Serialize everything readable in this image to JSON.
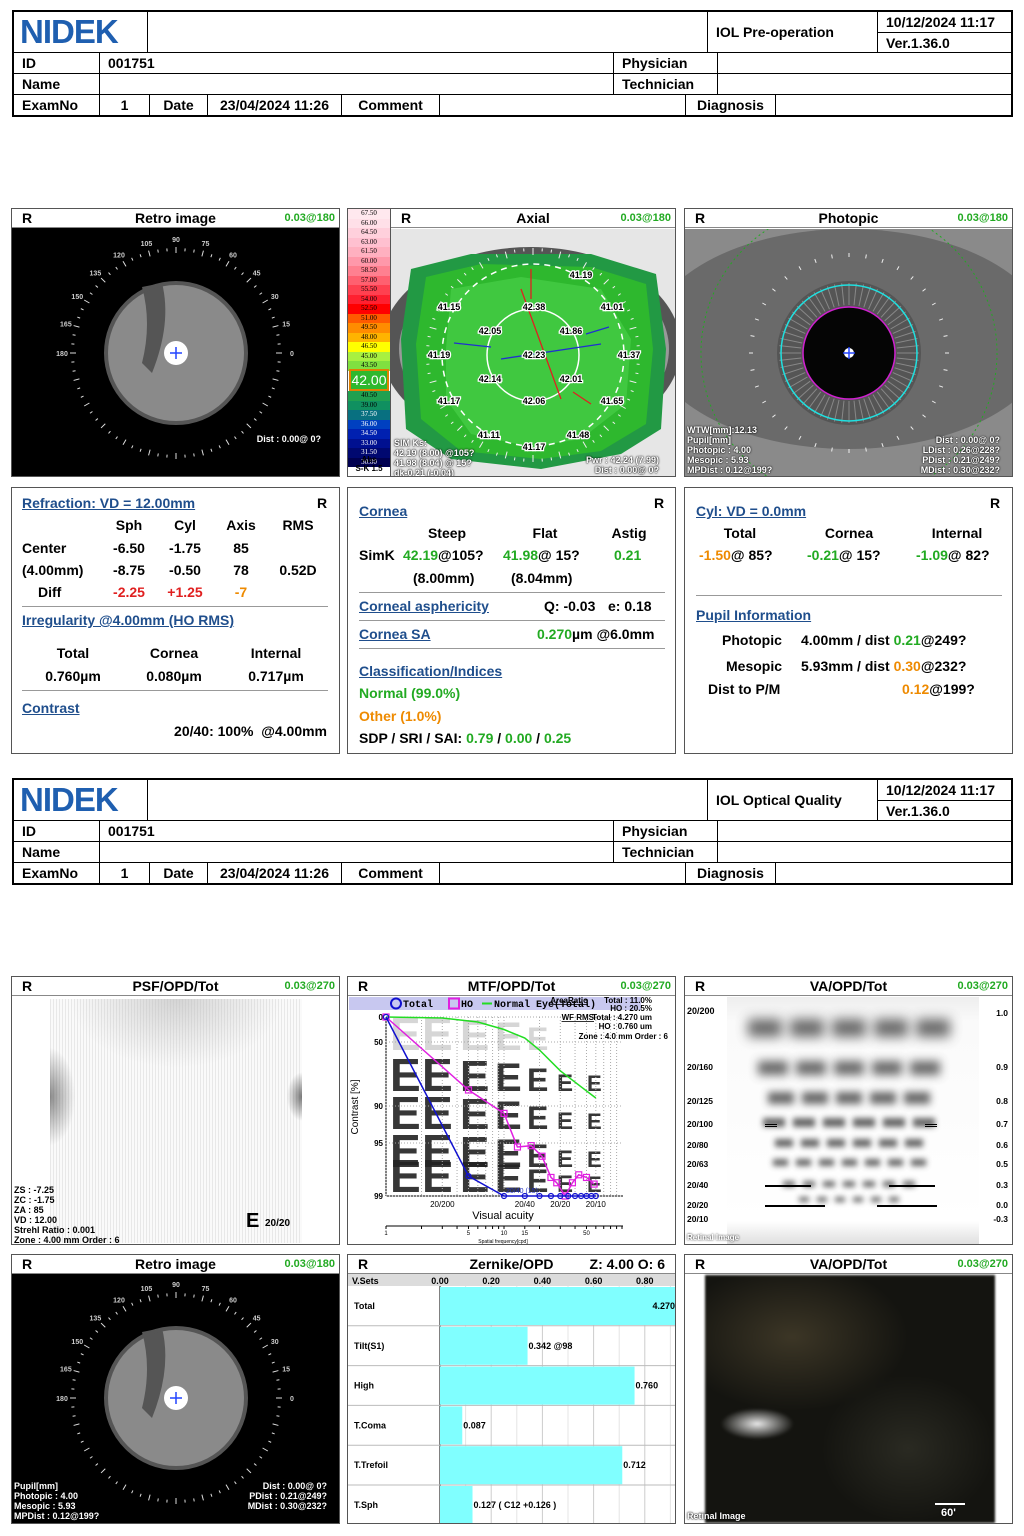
{
  "headers": [
    {
      "logo": "NIDEK",
      "report": "IOL Pre-operation",
      "datetime": "10/12/2024 11:17",
      "version": "Ver.1.36.0",
      "id_label": "ID",
      "id": "001751",
      "name_label": "Name",
      "name": "",
      "physician_label": "Physician",
      "physician": "",
      "technician_label": "Technician",
      "technician": "",
      "examno_label": "ExamNo",
      "examno": "1",
      "date_label": "Date",
      "date": "23/04/2024 11:26",
      "comment_label": "Comment",
      "diagnosis_label": "Diagnosis"
    },
    {
      "logo": "NIDEK",
      "report": "IOL Optical Quality",
      "datetime": "10/12/2024 11:17",
      "version": "Ver.1.36.0",
      "id_label": "ID",
      "id": "001751",
      "name_label": "Name",
      "name": "",
      "physician_label": "Physician",
      "physician": "",
      "technician_label": "Technician",
      "technician": "",
      "examno_label": "ExamNo",
      "examno": "1",
      "date_label": "Date",
      "date": "23/04/2024 11:26",
      "comment_label": "Comment",
      "diagnosis_label": "Diagnosis"
    }
  ],
  "eye": "R",
  "angle_labels": [
    "0",
    "15",
    "30",
    "45",
    "60",
    "75",
    "90",
    "105",
    "120",
    "135",
    "150",
    "165",
    "180"
  ],
  "retro1": {
    "title": "Retro image",
    "badge": "0.03@180",
    "dist": "Dist : 0.00@ 0?"
  },
  "axial": {
    "title": "Axial",
    "badge": "0.03@180",
    "scale": [
      "67.50",
      "66.00",
      "64.50",
      "63.00",
      "61.50",
      "60.00",
      "58.50",
      "57.00",
      "55.50",
      "54.00",
      "52.50",
      "51.00",
      "49.50",
      "48.00",
      "46.50",
      "45.00",
      "43.50",
      "42.00",
      "40.50",
      "39.00",
      "37.50",
      "36.00",
      "34.50",
      "33.00",
      "31.50",
      "30.00"
    ],
    "scale_selected": "42.00",
    "scale_mode": "Abs",
    "scale_step": "S-K 1.5",
    "values": [
      "41.19",
      "41.15",
      "42.38",
      "41.01",
      "42.05",
      "41.86",
      "41.19",
      "42.23",
      "41.37",
      "42.14",
      "42.01",
      "41.17",
      "42.06",
      "41.65",
      "41.11",
      "41.48",
      "41.17"
    ],
    "simk_lines": [
      "SIM Ks:",
      "42.19 (8.00) @105?",
      "41.98 (8.04) @ 15?",
      "dk-0.21 (-0.04)"
    ],
    "pwr": "Pwr : 42.24 (7.99)",
    "dist": "Dist : 0.00@ 0?"
  },
  "photopic": {
    "title": "Photopic",
    "badge": "0.03@180",
    "left_lines": [
      "WTW[mm]:12.13",
      "Pupil[mm]",
      "Photopic : 4.00",
      "Mesopic : 5.93",
      "MPDist : 0.12@199?"
    ],
    "right_lines": [
      "Dist : 0.00@ 0?",
      "LDist : 0.26@228?",
      "PDist : 0.21@249?",
      "MDist : 0.30@232?"
    ]
  },
  "refraction": {
    "title": "Refraction: VD = 12.00mm",
    "cols": [
      "Sph",
      "Cyl",
      "Axis",
      "RMS"
    ],
    "center_label": "Center",
    "center": [
      "-6.50",
      "-1.75",
      "85"
    ],
    "zone_label": "(4.00mm)",
    "zone": [
      "-8.75",
      "-0.50",
      "78",
      "0.52D"
    ],
    "diff_label": "Diff",
    "diff": [
      "-2.25",
      "+1.25",
      "-7"
    ],
    "irregularity_title": "Irregularity @4.00mm (HO RMS)",
    "irr_cols": [
      "Total",
      "Cornea",
      "Internal"
    ],
    "irr_vals": [
      "0.760µm",
      "0.080µm",
      "0.717µm"
    ],
    "contrast_title": "Contrast",
    "contrast_value": "20/40: 100%  @4.00mm"
  },
  "cornea": {
    "title": "Cornea",
    "cols": [
      "Steep",
      "Flat",
      "Astig"
    ],
    "simk_label": "SimK",
    "steep": "42.19",
    "steep_axis": "@105?",
    "flat": "41.98",
    "flat_axis": "@ 15?",
    "astig": "0.21",
    "steep_r": "(8.00mm)",
    "flat_r": "(8.04mm)",
    "asph_title": "Corneal asphericity",
    "q": "Q: -0.03",
    "e": "e: 0.18",
    "sa_title": "Cornea SA",
    "sa_value": "0.270",
    "sa_unit": "µm @6.0mm",
    "class_title": "Classification/Indices",
    "normal": "Normal (99.0%)",
    "other": "Other (1.0%)",
    "indices_label": "SDP / SRI / SAI:",
    "sdp": "0.79",
    "sri": "0.00",
    "sai": "0.25"
  },
  "cyl": {
    "title": "Cyl: VD = 0.0mm",
    "cols": [
      "Total",
      "Cornea",
      "Internal"
    ],
    "vals": [
      {
        "v": "-1.50",
        "a": "@ 85?"
      },
      {
        "v": "-0.21",
        "a": "@ 15?"
      },
      {
        "v": "-1.09",
        "a": "@ 82?"
      }
    ],
    "pupil_title": "Pupil Information",
    "photopic_label": "Photopic",
    "photopic_val": "4.00mm / dist",
    "photopic_dist": "0.21",
    "photopic_axis": "@249?",
    "mesopic_label": "Mesopic",
    "mesopic_val": "5.93mm / dist",
    "mesopic_dist": "0.30",
    "mesopic_axis": "@232?",
    "pm_label": "Dist to P/M",
    "pm_dist": "0.12",
    "pm_axis": "@199?"
  },
  "psf": {
    "title": "PSF/OPD/Tot",
    "badge": "0.03@270",
    "lines": [
      "ZS : -7.25",
      "ZC : -1.75",
      "ZA : 85",
      "VD : 12.00",
      "Strehl Ratio : 0.001",
      "Zone : 4.00 mm Order :  6"
    ],
    "va": "20/20"
  },
  "mtf": {
    "title": "MTF/OPD/Tot",
    "badge": "0.03@270",
    "legend": [
      "Total",
      "HO",
      "Normal Eye(Total)"
    ],
    "area_ratio_label": "AreaRatio",
    "area_total": "Total : 11.0%",
    "area_ho": "HO : 20.5%",
    "wf_label": "WF RMS",
    "wf_total": "Total : 4.270 um",
    "wf_ho": "HO : 0.760 um",
    "zone": "Zone : 4.0 mm  Order : 6",
    "annotation": "20/40 (15)"
  },
  "chart_data": {
    "type": "line",
    "xlabel": "Visual acuity",
    "x2label": "Spatial frequency[cpd]",
    "ylabel": "Contrast [%]",
    "x_scale": "log",
    "xlim": [
      1,
      100
    ],
    "yticks": [
      "0",
      "50",
      "90",
      "95",
      "99"
    ],
    "xticks_va": [
      "20/200",
      "20/40",
      "20/20",
      "20/10"
    ],
    "xticks_cpd": [
      "1",
      "5",
      "10",
      "15",
      "50"
    ],
    "series": [
      {
        "name": "Total",
        "color": "#1010d0",
        "marker": "circle",
        "points": [
          [
            1,
            0
          ],
          [
            5,
            97.5
          ],
          [
            10,
            99
          ],
          [
            15,
            99
          ],
          [
            20,
            99
          ],
          [
            25,
            99
          ],
          [
            30,
            99
          ],
          [
            35,
            99
          ],
          [
            40,
            99
          ],
          [
            45,
            99
          ],
          [
            50,
            99
          ],
          [
            55,
            99
          ],
          [
            60,
            99
          ]
        ]
      },
      {
        "name": "HO",
        "color": "#e020e0",
        "marker": "square",
        "points": [
          [
            1,
            0
          ],
          [
            5,
            80
          ],
          [
            10,
            91
          ],
          [
            13,
            95.3
          ],
          [
            17,
            95.2
          ],
          [
            21,
            96
          ],
          [
            25,
            97.6
          ],
          [
            28,
            98
          ],
          [
            33,
            99
          ],
          [
            38,
            98
          ],
          [
            43,
            97.4
          ],
          [
            50,
            97.6
          ],
          [
            58,
            98.1
          ]
        ]
      },
      {
        "name": "Normal Eye(Total)",
        "color": "#22dd22",
        "marker": "none",
        "points": [
          [
            1,
            0
          ],
          [
            3,
            2
          ],
          [
            6,
            10
          ],
          [
            10,
            25
          ],
          [
            15,
            42
          ],
          [
            20,
            55
          ],
          [
            30,
            68
          ],
          [
            45,
            78
          ],
          [
            60,
            85
          ]
        ]
      }
    ]
  },
  "va1": {
    "title": "VA/OPD/Tot",
    "badge": "0.03@270",
    "snellen": [
      "20/200",
      "20/160",
      "20/125",
      "20/100",
      "20/80",
      "20/63",
      "20/40",
      "20/20",
      "20/10"
    ],
    "decimal": [
      "1.0",
      "0.9",
      "0.8",
      "0.7",
      "0.6",
      "0.5",
      "0.3",
      "0.0",
      "-0.3"
    ],
    "footer": "Retinal Image"
  },
  "retro2": {
    "title": "Retro image",
    "badge": "0.03@180",
    "left_lines": [
      "Pupil[mm]",
      "Photopic : 4.00",
      "Mesopic : 5.93",
      "MPDist : 0.12@199?"
    ],
    "right_lines": [
      "Dist : 0.00@ 0?",
      "PDist : 0.21@249?",
      "MDist : 0.30@232?"
    ]
  },
  "zernike": {
    "title": "Zernike/OPD",
    "zo": "Z: 4.00 O: 6",
    "header": "V.Sets",
    "ticks": [
      "0.00",
      "0.20",
      "0.40",
      "0.60",
      "0.80"
    ],
    "bars": [
      {
        "label": "Total",
        "value": 4.27,
        "text": "4.270"
      },
      {
        "label": "Tilt(S1)",
        "value": 0.342,
        "text": "0.342 @98"
      },
      {
        "label": "High",
        "value": 0.76,
        "text": "0.760"
      },
      {
        "label": "T.Coma",
        "value": 0.087,
        "text": "0.087"
      },
      {
        "label": "T.Trefoil",
        "value": 0.712,
        "text": "0.712"
      },
      {
        "label": "T.Sph",
        "value": 0.127,
        "text": "0.127 ( C12 +0.126 )"
      }
    ],
    "bar_color": "#80ffff"
  },
  "va2": {
    "title": "VA/OPD/Tot",
    "badge": "0.03@270",
    "footer": "Retinal Image",
    "scale": "60'"
  }
}
